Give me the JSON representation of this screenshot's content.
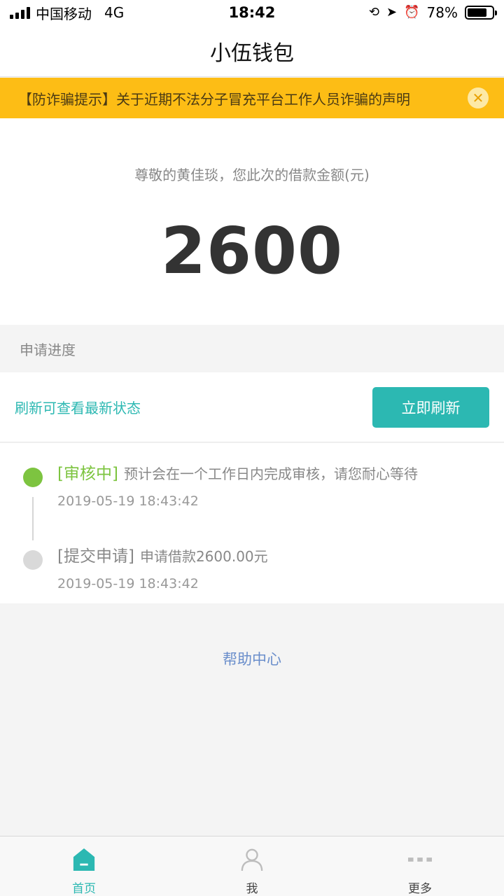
{
  "status_bar": {
    "carrier": "中国移动",
    "network": "4G",
    "time": "18:42",
    "battery": "78%",
    "battery_level": 0.78
  },
  "nav": {
    "title": "小伍钱包"
  },
  "notice": {
    "text": "【防诈骗提示】关于近期不法分子冒充平台工作人员诈骗的声明",
    "close_icon": "close-icon"
  },
  "amount": {
    "label": "尊敬的黄佳琰，您此次的借款金额(元)",
    "value": "2600"
  },
  "progress": {
    "section_title": "申请进度",
    "refresh_hint": "刷新可查看最新状态",
    "refresh_button": "立即刷新"
  },
  "timeline": [
    {
      "status": "[审核中]",
      "desc": "预计会在一个工作日内完成审核，请您耐心等待",
      "time": "2019-05-19 18:43:42",
      "color": "#7dc440"
    },
    {
      "status": "[提交申请]",
      "desc": "申请借款2600.00元",
      "time": "2019-05-19 18:43:42",
      "color": "#d9d9d9"
    }
  ],
  "help": {
    "label": "帮助中心"
  },
  "tabs": [
    {
      "label": "首页",
      "icon": "home-icon",
      "active": true
    },
    {
      "label": "我",
      "icon": "user-icon",
      "active": false
    },
    {
      "label": "更多",
      "icon": "more-icon",
      "active": false
    }
  ],
  "colors": {
    "accent": "#2cb8b2",
    "notice_bg": "#fdbd15",
    "link": "#6a8ecb"
  }
}
